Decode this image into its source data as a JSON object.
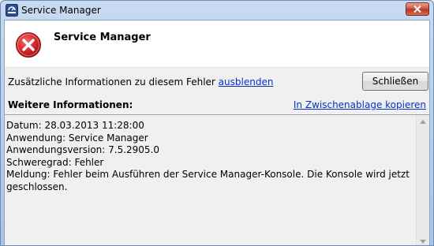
{
  "window": {
    "title": "Service Manager",
    "app_icon": "service-manager-icon",
    "close_icon": "close-icon"
  },
  "header": {
    "icon": "error-icon",
    "title": "Service Manager"
  },
  "info": {
    "prefix": "Zusätzliche Informationen zu diesem Fehler ",
    "toggle_link": "ausblenden"
  },
  "buttons": {
    "close_label": "Schließen"
  },
  "details": {
    "heading": "Weitere Informationen:",
    "copy_link": "In Zwischenablage kopieren",
    "text": "Datum: 28.03.2013 11:28:00\nAnwendung: Service Manager\nAnwendungsversion: 7.5.2905.0\nSchweregrad: Fehler\nMeldung: Fehler beim Ausführen der Service Manager-Konsole. Die Konsole wird jetzt\ngeschlossen."
  },
  "colors": {
    "link": "#0033cc",
    "error_red": "#c8202c",
    "title_bar": "#a9c4e6"
  }
}
